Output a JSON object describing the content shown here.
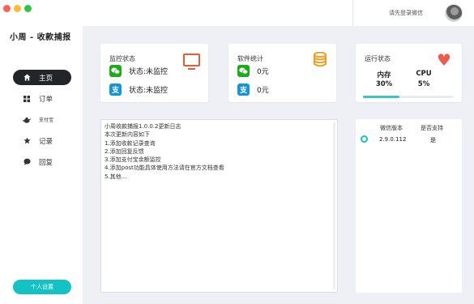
{
  "app": {
    "title": "小周 - 收款捕报"
  },
  "window_controls": {
    "colors": [
      "#ff5f57",
      "#febc2e",
      "#28c840"
    ]
  },
  "sidebar": {
    "items": [
      {
        "label": "主页",
        "icon": "home-icon",
        "active": true
      },
      {
        "label": "订单",
        "icon": "grid-icon",
        "active": false
      },
      {
        "label": "支付宝",
        "icon": "teapot-icon",
        "active": false
      },
      {
        "label": "记录",
        "icon": "star-icon",
        "active": false
      },
      {
        "label": "回复",
        "icon": "chat-bubble-icon",
        "active": false
      }
    ],
    "settings_button": "个人设置"
  },
  "header": {
    "login_text": "请先登录微信"
  },
  "monitor_card": {
    "title": "监控状态",
    "wechat_status": "状态:未监控",
    "alipay_status": "状态:未监控",
    "icon": "monitor-icon"
  },
  "stats_card": {
    "title": "软件统计",
    "wechat_amount": "0元",
    "alipay_amount": "0元",
    "icon": "coins-icon"
  },
  "runtime_card": {
    "title": "运行状态",
    "memory_label": "内存",
    "memory_value": "30%",
    "cpu_label": "CPU",
    "cpu_value": "5%",
    "progress": 0.4,
    "icon": "heart-icon"
  },
  "log": {
    "lines": [
      "小周收款捕报1.0.0.2更新日志",
      "本次更新内容如下",
      "1.添加收款记录查询",
      "2.添加回复反馈",
      "3.添加支付宝余额监控",
      "4.添加post功能具体使用方法请在官方文档查看",
      "5.其他..."
    ]
  },
  "version_panel": {
    "headers": [
      "微信版本",
      "是否支持"
    ],
    "rows": [
      {
        "version": "2.9.0.112",
        "supported": "是"
      }
    ]
  },
  "colors": {
    "accent": "#13c2c2",
    "active_nav": "#232529",
    "wechat": "#1aad19",
    "alipay": "#1296db",
    "heart": "#ef5a4c",
    "monitor": "#e25d33",
    "coins": "#f0a020"
  }
}
